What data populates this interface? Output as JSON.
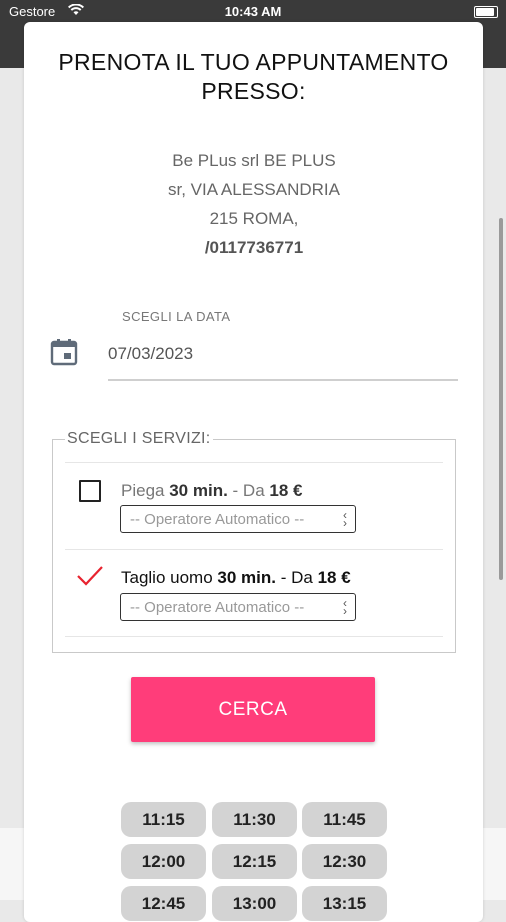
{
  "status_bar": {
    "carrier": "Gestore",
    "time": "10:43 AM"
  },
  "booking": {
    "title": "PRENOTA IL TUO APPUNTAMENTO PRESSO:",
    "address_lines": [
      "Be PLus srl BE PLUS",
      "sr, VIA ALESSANDRIA",
      "215 ROMA,"
    ],
    "phone": "/0117736771",
    "date_label": "SCEGLI LA DATA",
    "date_value": "07/03/2023",
    "services_legend": "SCEGLI I SERVIZI:",
    "services": [
      {
        "name": "Piega",
        "duration": "30 min.",
        "separator": " - Da ",
        "price": "18 €",
        "checked": false,
        "operator": "-- Operatore Automatico --"
      },
      {
        "name": "Taglio uomo",
        "duration": "30 min.",
        "separator": " - Da ",
        "price": "18 €",
        "checked": true,
        "operator": "-- Operatore Automatico --"
      }
    ],
    "search_button": "CERCA",
    "time_slots": [
      "11:15",
      "11:30",
      "11:45",
      "12:00",
      "12:15",
      "12:30",
      "12:45",
      "13:00",
      "13:15"
    ]
  },
  "colors": {
    "accent": "#ff3d7a",
    "check_red": "#e8232f",
    "slot_bg": "#d3d3d3"
  }
}
